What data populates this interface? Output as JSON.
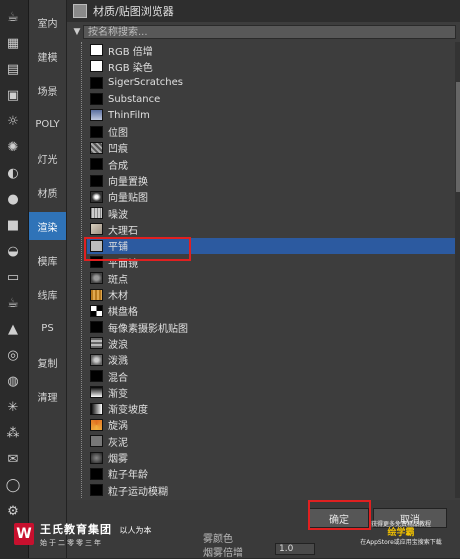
{
  "categories": [
    {
      "label": "室内",
      "active": false
    },
    {
      "label": "建模",
      "active": false
    },
    {
      "label": "场景",
      "active": false
    },
    {
      "label": "POLY",
      "active": false
    },
    {
      "label": "灯光",
      "active": false
    },
    {
      "label": "材质",
      "active": false
    },
    {
      "label": "渲染",
      "active": true
    },
    {
      "label": "模库",
      "active": false
    },
    {
      "label": "线库",
      "active": false
    },
    {
      "label": "PS",
      "active": false
    },
    {
      "label": "复制",
      "active": false
    },
    {
      "label": "清理",
      "active": false
    }
  ],
  "toolbar_icons": [
    "teapot-icon",
    "render-setup-icon",
    "material-editor-icon",
    "render-frame-icon",
    "lamp-icon",
    "sun-icon",
    "camera-icon",
    "sphere-icon",
    "box-icon",
    "dome-icon",
    "plane-icon",
    "teapot-small-icon",
    "cone-icon",
    "torus-icon",
    "geosphere-icon",
    "particle-icon",
    "helix-icon",
    "envelope-icon",
    "globe-icon",
    "gear-icon"
  ],
  "dialog": {
    "title": "材质/贴图浏览器",
    "search_placeholder": "按名称搜索...",
    "items": [
      {
        "label": "RGB 倍增",
        "thumb": "#ffffff"
      },
      {
        "label": "RGB 染色",
        "thumb": "#ffffff"
      },
      {
        "label": "SigerScratches",
        "thumb": "#000000"
      },
      {
        "label": "Substance",
        "thumb": "#000000"
      },
      {
        "label": "ThinFilm",
        "thumb": "linear-gradient(#5b6fa0,#c0c8e0)"
      },
      {
        "label": "位图",
        "thumb": "#000000"
      },
      {
        "label": "凹痕",
        "thumb": "repeating-linear-gradient(45deg,#555 0 2px,#aaa 2px 4px)"
      },
      {
        "label": "合成",
        "thumb": "#000000"
      },
      {
        "label": "向量置换",
        "thumb": "#000000"
      },
      {
        "label": "向量贴图",
        "thumb": "radial-gradient(#fff 20%,#333 60%)"
      },
      {
        "label": "噪波",
        "thumb": "repeating-linear-gradient(90deg,#888 0 1px,#ccc 1px 3px)"
      },
      {
        "label": "大理石",
        "thumb": "linear-gradient(135deg,#d8d0c0,#9c8f80)"
      },
      {
        "label": "平铺",
        "thumb": "#bbbbbb",
        "selected": true
      },
      {
        "label": "平面镜",
        "thumb": "#000000"
      },
      {
        "label": "斑点",
        "thumb": "radial-gradient(#999 30%,#444 70%)"
      },
      {
        "label": "木材",
        "thumb": "repeating-linear-gradient(90deg,#b7791f 0 2px,#e0a850 2px 4px)"
      },
      {
        "label": "棋盘格",
        "thumb": "conic-gradient(#000 0 25%,#fff 0 50%,#000 0 75%,#fff 0)"
      },
      {
        "label": "每像素摄影机贴图",
        "thumb": "#000000"
      },
      {
        "label": "波浪",
        "thumb": "repeating-linear-gradient(0deg,#666 0 2px,#bbb 2px 4px)"
      },
      {
        "label": "泼溅",
        "thumb": "radial-gradient(#ccc 25%,#666 70%)"
      },
      {
        "label": "混合",
        "thumb": "#000000"
      },
      {
        "label": "渐变",
        "thumb": "linear-gradient(#000,#fff)"
      },
      {
        "label": "渐变坡度",
        "thumb": "linear-gradient(90deg,#000,#fff)"
      },
      {
        "label": "旋涡",
        "thumb": "conic-gradient(#e07020,#f0b040,#e07020)"
      },
      {
        "label": "灰泥",
        "thumb": "#777777"
      },
      {
        "label": "烟雾",
        "thumb": "radial-gradient(#888,#222)"
      },
      {
        "label": "粒子年龄",
        "thumb": "#000000"
      },
      {
        "label": "粒子运动模糊",
        "thumb": "#000000"
      }
    ],
    "ok_label": "确定",
    "cancel_label": "取消"
  },
  "bottom_panel": {
    "label1": "雾颜色",
    "label2": "烟雾倍增",
    "spinner_value": "1.0"
  },
  "brand": {
    "logo": "W",
    "name": "王氏教育集团",
    "slogan": "以人为本",
    "sub": "始于二零零三年"
  },
  "promo": {
    "line1": "获得更多免费精品教程",
    "app": "绘学霸",
    "line2": "在AppStore或应用宝搜索下载"
  },
  "colors": {
    "accent_blue": "#2f73b8",
    "selection": "#2c5aa0",
    "annotation_red": "#e02020"
  }
}
